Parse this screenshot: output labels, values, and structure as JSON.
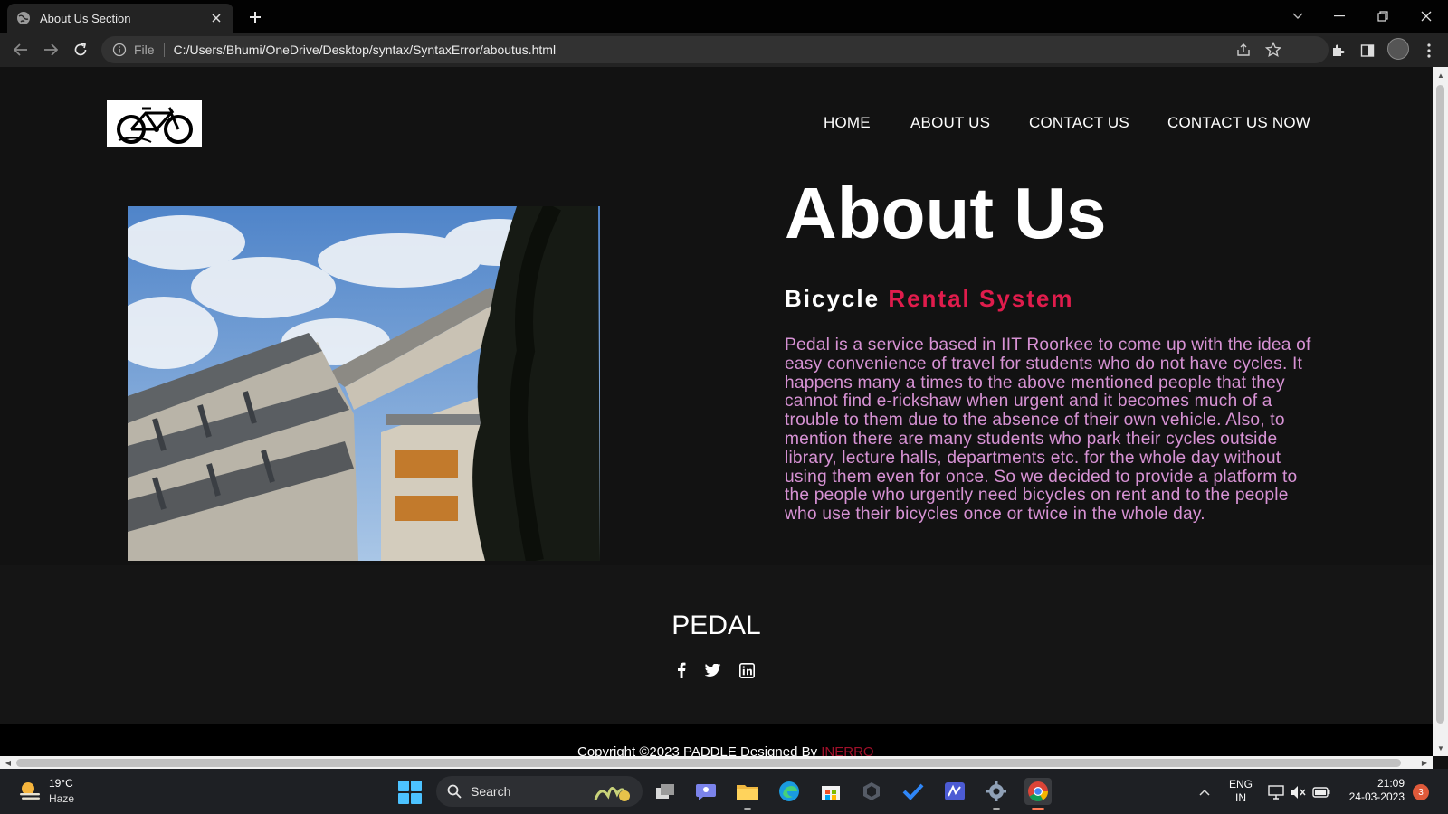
{
  "browser": {
    "tab_title": "About Us Section",
    "omnibox_scheme": "File",
    "omnibox_url": "C:/Users/Bhumi/OneDrive/Desktop/syntax/SyntaxError/aboutus.html"
  },
  "site": {
    "nav": [
      "HOME",
      "ABOUT US",
      "CONTACT US",
      "CONTACT US NOW"
    ],
    "about": {
      "title": "About Us",
      "subtitle_white": "Bicycle",
      "subtitle_red": "Rental System",
      "body": "Pedal is a service based in IIT Roorkee to come up with the idea of easy convenience of travel for students who do not have cycles. It happens many a times to the above mentioned people that they cannot find e-rickshaw when urgent and it becomes much of a trouble to them due to the absence of their own vehicle. Also, to mention there are many students who park their cycles outside library, lecture halls, departments etc. for the whole day without using them even for once. So we decided to provide a platform to the people who urgently need bicycles on rent and to the people who use their bicycles once or twice in the whole day."
    },
    "footer": {
      "brand": "PEDAL",
      "social": [
        "facebook-icon",
        "twitter-icon",
        "linkedin-icon"
      ],
      "copyright_prefix": "Copyright ©2023 PADDLE Designed By",
      "copyright_name": "INERRO"
    },
    "colors": {
      "accent_red": "#e01c4c",
      "body_pink": "#d792d4",
      "background": "#121212"
    }
  },
  "taskbar": {
    "weather_temp": "19°C",
    "weather_condition": "Haze",
    "search_label": "Search",
    "lang_top": "ENG",
    "lang_bottom": "IN",
    "time": "21:09",
    "date": "24-03-2023",
    "notification_count": "3"
  }
}
